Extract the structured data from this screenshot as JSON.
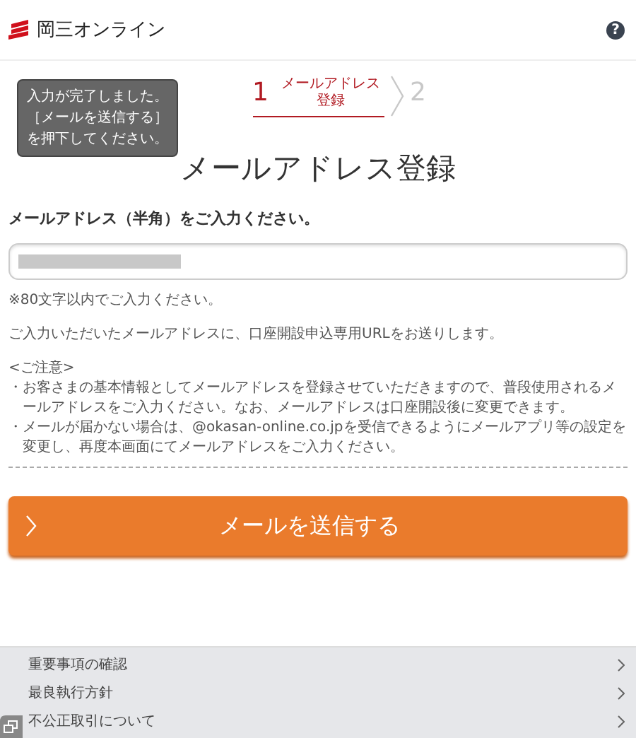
{
  "header": {
    "logo_text": "岡三オンライン",
    "help": "?"
  },
  "steps": [
    {
      "number": "1",
      "label_lines": [
        "メールアドレス",
        "登録"
      ],
      "selected": true
    },
    {
      "number": "2",
      "selected": false
    }
  ],
  "tooltip": {
    "lines": [
      "入力が完了しました。",
      "［メールを送信する］",
      "を押下してください。"
    ]
  },
  "title": "メールアドレス登録",
  "email_field": {
    "label": "メールアドレス（半角）をご入力ください。",
    "redacted": true
  },
  "hint": "※80文字以内でご入力ください。",
  "info": "ご入力いただいたメールアドレスに、口座開設申込専用URLをお送りします。",
  "notice": {
    "heading": "<ご注意>",
    "items": [
      "・お客さまの基本情報としてメールアドレスを登録させていただきますので、普段使用されるメールアドレスをご入力ください。なお、メールアドレスは口座開設後に変更できます。",
      "・メールが届かない場合は、@okasan-online.co.jpを受信できるようにメールアプリ等の設定を変更し、再度本画面にてメールアドレスをご入力ください。"
    ]
  },
  "submit_button": "メールを送信する",
  "footer_links": [
    "重要事項の確認",
    "最良執行方針",
    "不公正取引について"
  ]
}
